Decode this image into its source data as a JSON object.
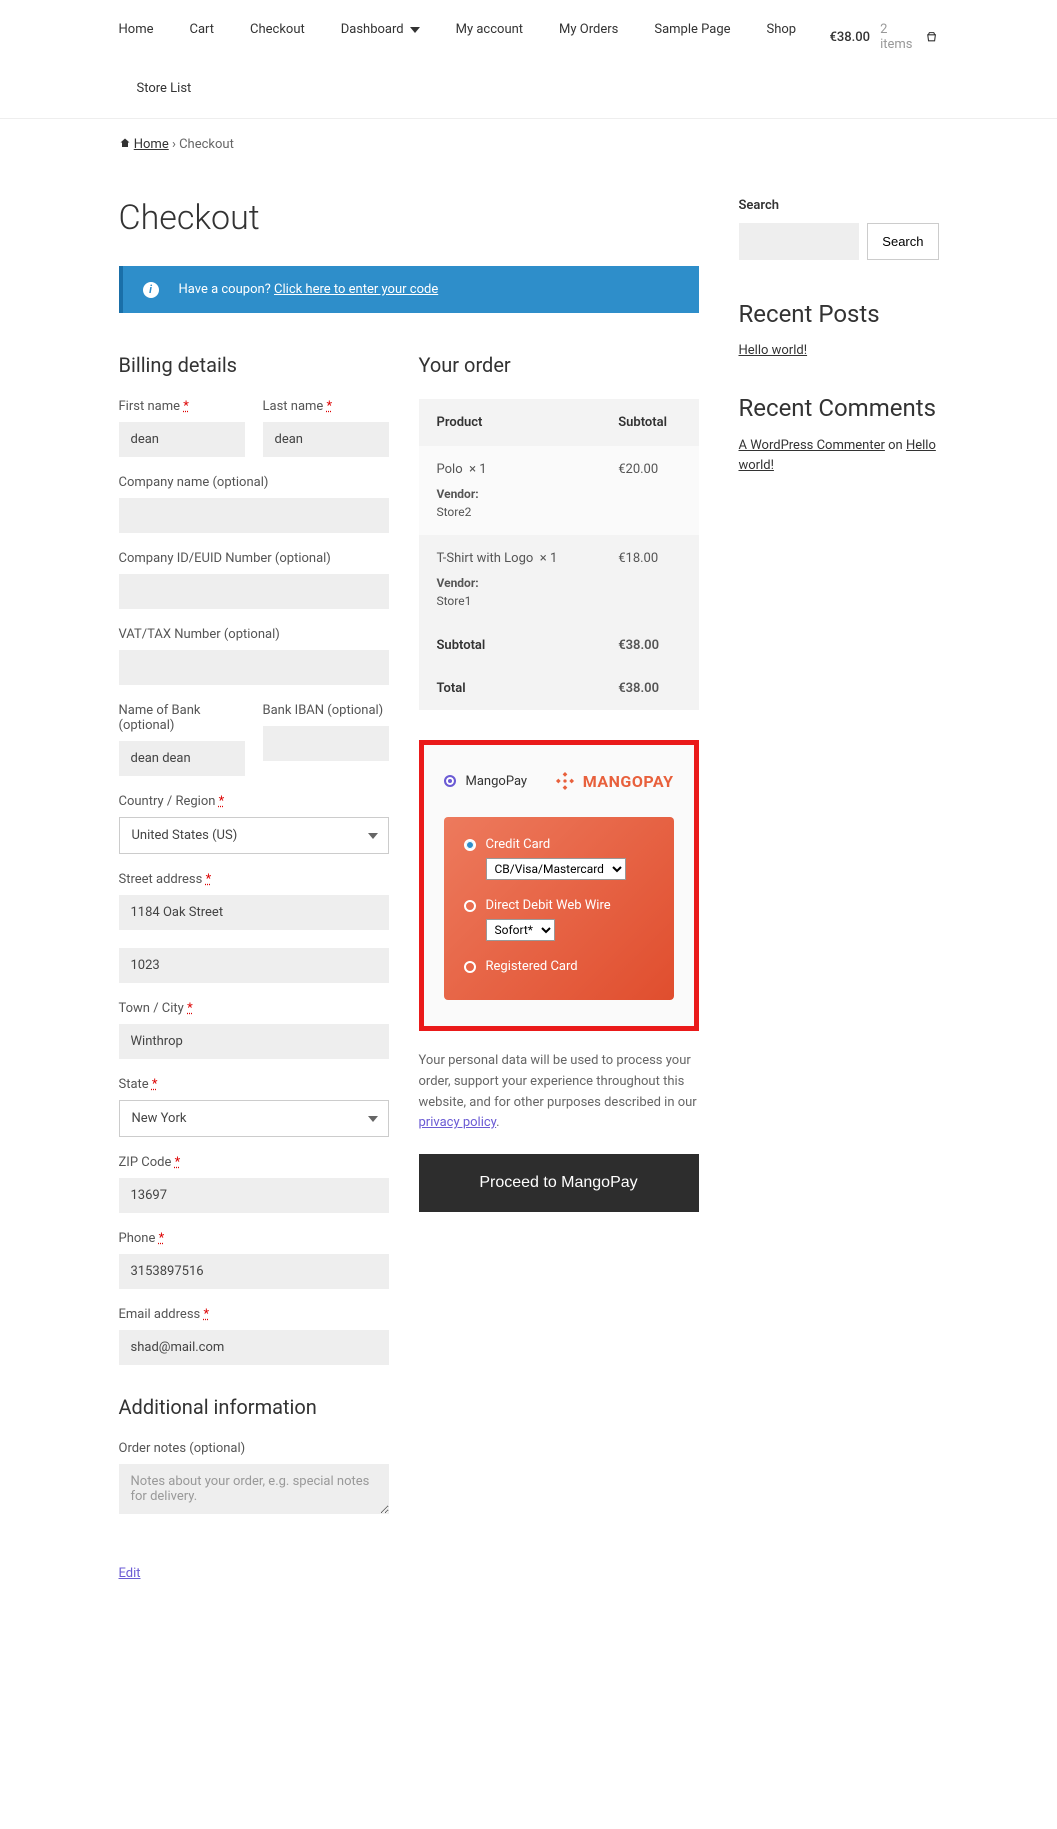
{
  "nav": {
    "items": [
      "Home",
      "Cart",
      "Checkout",
      "Dashboard",
      "My account",
      "My Orders",
      "Sample Page",
      "Shop",
      "Store List"
    ],
    "cart_total": "€38.00",
    "cart_items": "2 items"
  },
  "breadcrumb": {
    "home": "Home",
    "current": "Checkout"
  },
  "page_title": "Checkout",
  "coupon": {
    "prompt": "Have a coupon? ",
    "link": "Click here to enter your code"
  },
  "billing": {
    "heading": "Billing details",
    "first_name_label": "First name ",
    "first_name": "dean",
    "last_name_label": "Last name ",
    "last_name": "dean",
    "company_label": "Company name (optional)",
    "company": "",
    "company_id_label": "Company ID/EUID Number (optional)",
    "company_id": "",
    "vat_label": "VAT/TAX Number (optional)",
    "vat": "",
    "bank_name_label": "Name of Bank (optional)",
    "bank_name": "dean dean",
    "bank_iban_label": "Bank IBAN (optional)",
    "bank_iban": "",
    "country_label": "Country / Region ",
    "country": "United States (US)",
    "street_label": "Street address ",
    "street1": "1184 Oak Street",
    "street2": "1023",
    "city_label": "Town / City ",
    "city": "Winthrop",
    "state_label": "State ",
    "state": "New York",
    "zip_label": "ZIP Code ",
    "zip": "13697",
    "phone_label": "Phone ",
    "phone": "3153897516",
    "email_label": "Email address ",
    "email": "shad@mail.com"
  },
  "additional": {
    "heading": "Additional information",
    "notes_label": "Order notes (optional)",
    "notes_placeholder": "Notes about your order, e.g. special notes for delivery."
  },
  "edit_link": "Edit",
  "order": {
    "heading": "Your order",
    "product_col": "Product",
    "subtotal_col": "Subtotal",
    "items": [
      {
        "name": "Polo",
        "qty": "× 1",
        "price": "€20.00",
        "vendor_label": "Vendor:",
        "vendor": "Store2"
      },
      {
        "name": "T-Shirt with Logo",
        "qty": "× 1",
        "price": "€18.00",
        "vendor_label": "Vendor:",
        "vendor": "Store1"
      }
    ],
    "subtotal_label": "Subtotal",
    "subtotal": "€38.00",
    "total_label": "Total",
    "total": "€38.00"
  },
  "payment": {
    "method_label": "MangoPay",
    "logo_text": "MANGOPAY",
    "credit_card_label": "Credit Card",
    "credit_card_option": "CB/Visa/Mastercard",
    "direct_debit_label": "Direct Debit Web Wire",
    "direct_debit_option": "Sofort*",
    "registered_label": "Registered Card",
    "privacy_text": "Your personal data will be used to process your order, support your experience throughout this website, and for other purposes described in our ",
    "privacy_link": "privacy policy",
    "proceed_btn": "Proceed to MangoPay"
  },
  "sidebar": {
    "search_heading": "Search",
    "search_btn": "Search",
    "recent_posts_heading": "Recent Posts",
    "recent_post_link": "Hello world!",
    "recent_comments_heading": "Recent Comments",
    "commenter": "A WordPress Commenter",
    "on": " on ",
    "comment_post": "Hello world!"
  }
}
